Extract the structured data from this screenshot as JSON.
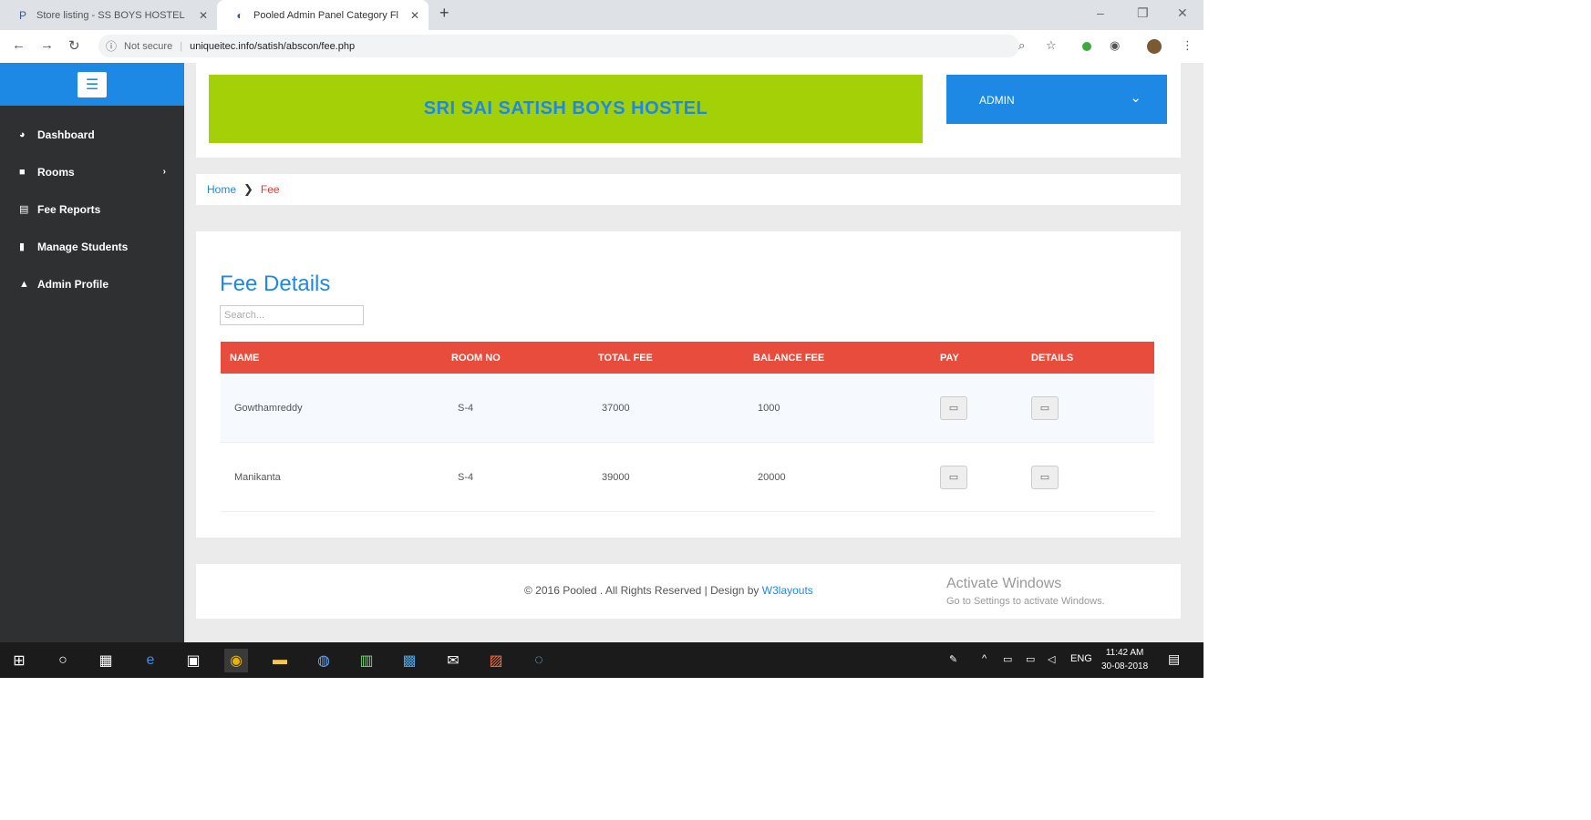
{
  "browser": {
    "tabs": [
      {
        "title": "Store listing - SS BOYS HOSTEL",
        "active": false
      },
      {
        "title": "Pooled Admin Panel Category Fl",
        "active": true
      }
    ],
    "new_tab": "+",
    "security_label": "Not secure",
    "url": "uniqueitec.info/satish/abscon/fee.php"
  },
  "sidebar": {
    "items": [
      {
        "label": "Dashboard",
        "icon": "dashboard-icon"
      },
      {
        "label": "Rooms",
        "icon": "folder-icon",
        "has_submenu": true
      },
      {
        "label": "Fee Reports",
        "icon": "reports-icon"
      },
      {
        "label": "Manage Students",
        "icon": "file-icon"
      },
      {
        "label": "Admin Profile",
        "icon": "user-icon"
      }
    ]
  },
  "header": {
    "hostel_name": "SRI SAI SATISH BOYS HOSTEL",
    "admin_label": "ADMIN"
  },
  "breadcrumb": {
    "home": "Home",
    "current": "Fee"
  },
  "main": {
    "title": "Fee Details",
    "search_placeholder": "Search..."
  },
  "table": {
    "columns": [
      "NAME",
      "ROOM NO",
      "TOTAL FEE",
      "BALANCE FEE",
      "PAY",
      "DETAILS"
    ],
    "rows": [
      {
        "name": "Gowthamreddy",
        "room": "S-4",
        "total": "37000",
        "balance": "1000"
      },
      {
        "name": "Manikanta",
        "room": "S-4",
        "total": "39000",
        "balance": "20000"
      }
    ]
  },
  "footer": {
    "copyright": "© 2016 Pooled . All Rights Reserved | Design by",
    "designer": "W3layouts"
  },
  "watermark": {
    "title": "Activate Windows",
    "subtitle": "Go to Settings to activate Windows."
  },
  "taskbar": {
    "lang": "ENG",
    "time": "11:42 AM",
    "date": "30-08-2018"
  },
  "colors": {
    "accent_blue": "#1e88e5",
    "banner_green": "#a4d007",
    "table_header_red": "#e74c3c",
    "sidebar_dark": "#2f3031"
  }
}
